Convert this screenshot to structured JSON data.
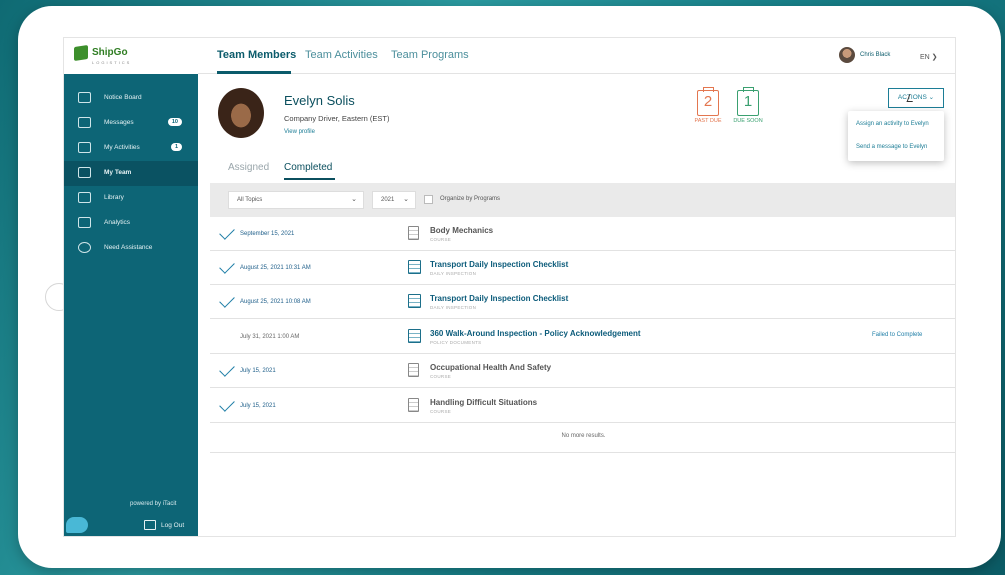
{
  "app": {
    "logo_name": "ShipGo",
    "logo_sub": "LOGISTICS"
  },
  "nav_tabs": [
    "Team Members",
    "Team Activities",
    "Team Programs"
  ],
  "user": {
    "name": "Chris Black",
    "lang": "EN ❯"
  },
  "sidebar": {
    "items": [
      {
        "label": "Notice Board",
        "badge": ""
      },
      {
        "label": "Messages",
        "badge": "10"
      },
      {
        "label": "My Activities",
        "badge": "1"
      },
      {
        "label": "My Team",
        "badge": ""
      },
      {
        "label": "Library",
        "badge": ""
      },
      {
        "label": "Analytics",
        "badge": ""
      },
      {
        "label": "Need Assistance",
        "badge": ""
      }
    ],
    "powered": "powered by iTacit",
    "logout": "Log Out"
  },
  "profile": {
    "name": "Evelyn Solis",
    "role": "Company Driver, Eastern (EST)",
    "link": "View profile"
  },
  "stats": {
    "past_count": "2",
    "past_label": "PAST DUE",
    "due_count": "1",
    "due_label": "DUE SOON"
  },
  "actions": {
    "label": "ACTIONS ⌄",
    "options": [
      "Assign an activity to Evelyn",
      "Send a message to Evelyn"
    ]
  },
  "subtabs": [
    "Assigned",
    "Completed"
  ],
  "filters": {
    "topic": "All Topics",
    "year": "2021",
    "organize": "Organize by Programs"
  },
  "rows": [
    {
      "date": "September 15, 2021",
      "title": "Body Mechanics",
      "type": "COURSE",
      "status": "",
      "done": true
    },
    {
      "date": "August 25, 2021 10:31 AM",
      "title": "Transport Daily Inspection Checklist",
      "type": "DAILY INSPECTION",
      "status": "",
      "done": true
    },
    {
      "date": "August 25, 2021 10:08 AM",
      "title": "Transport Daily Inspection Checklist",
      "type": "DAILY INSPECTION",
      "status": "",
      "done": true
    },
    {
      "date": "July 31, 2021 1:00 AM",
      "title": "360 Walk-Around Inspection - Policy Acknowledgement",
      "type": "POLICY DOCUMENTS",
      "status": "Failed to Complete",
      "done": false
    },
    {
      "date": "July 15, 2021",
      "title": "Occupational Health And Safety",
      "type": "COURSE",
      "status": "",
      "done": true
    },
    {
      "date": "July 15, 2021",
      "title": "Handling Difficult Situations",
      "type": "COURSE",
      "status": "",
      "done": true
    }
  ],
  "no_more": "No more results."
}
